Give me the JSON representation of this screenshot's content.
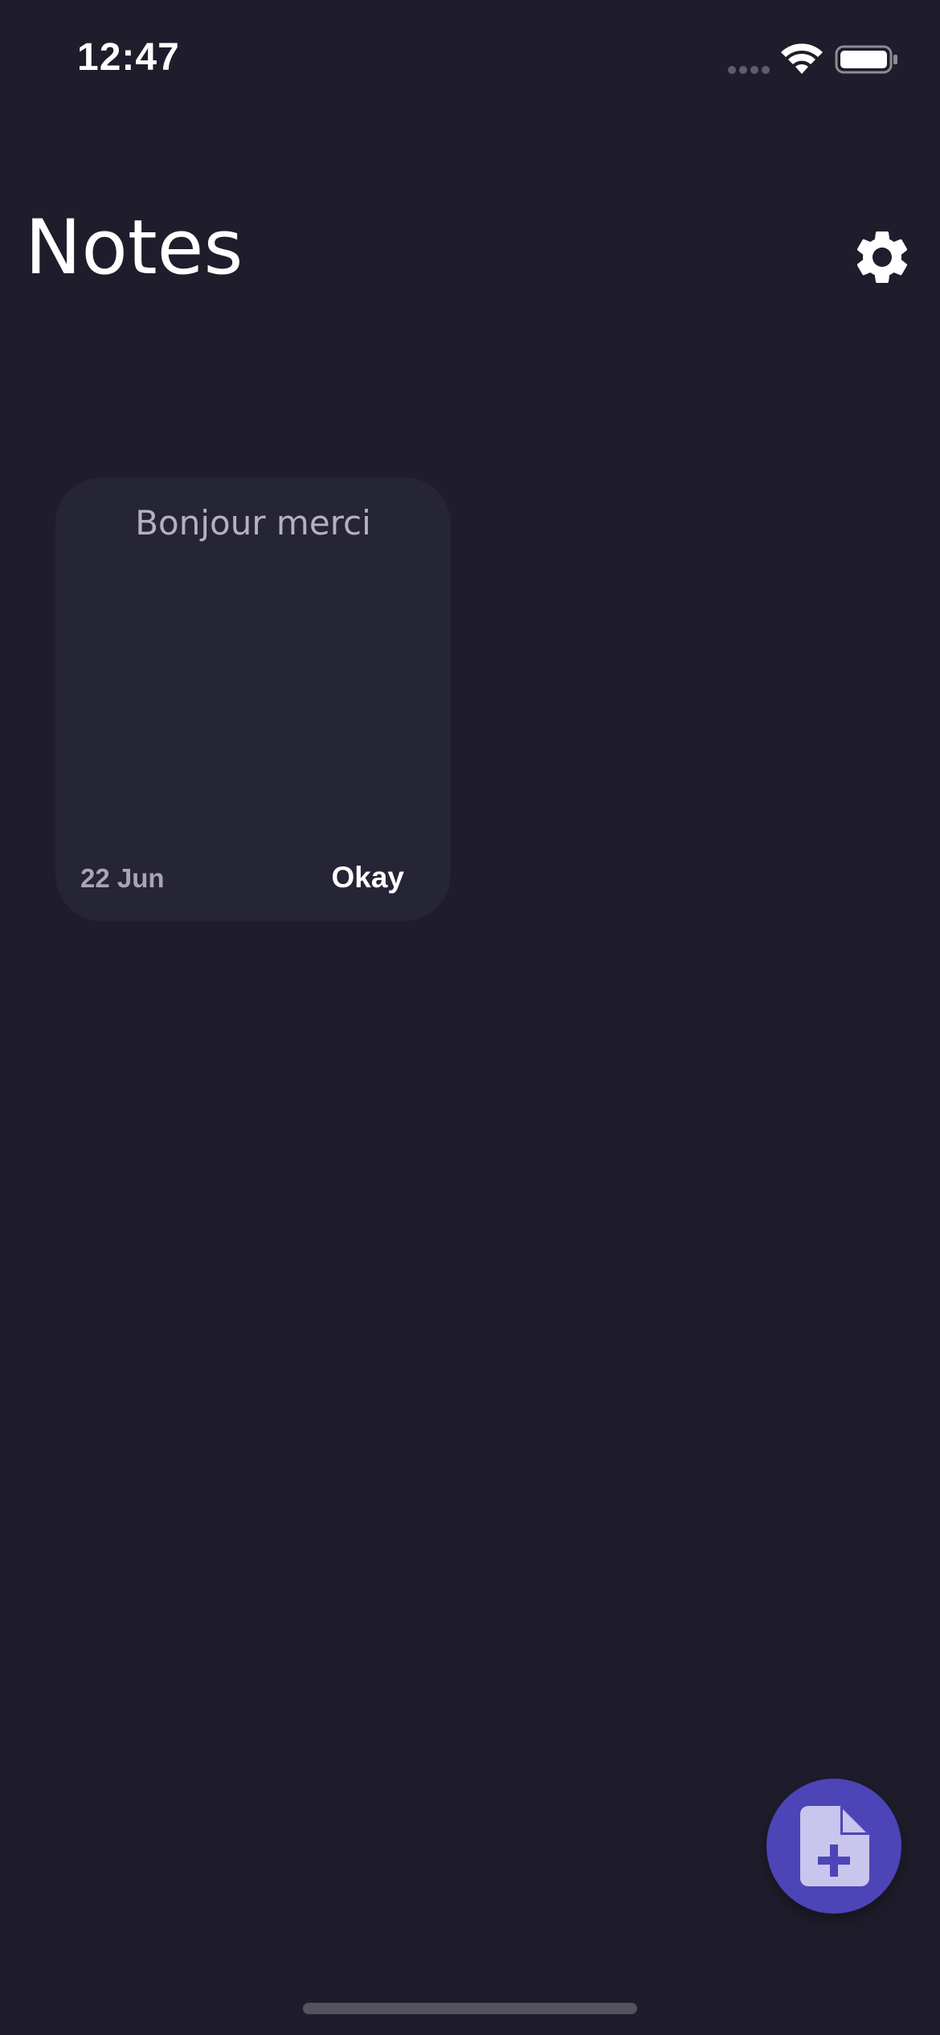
{
  "status_bar": {
    "time": "12:47",
    "icons": [
      "signal-icon",
      "wifi-icon",
      "battery-icon"
    ]
  },
  "header": {
    "title": "Notes",
    "settings_icon": "gear-icon"
  },
  "notes": [
    {
      "title": "Bonjour merci",
      "date": "22 Jun",
      "tag": "Okay"
    }
  ],
  "fab": {
    "icon": "add-note-icon"
  },
  "colors": {
    "background": "#1f1d2b",
    "card": "#262536",
    "accent": "#4d44b8",
    "accent_light": "#c9c5ec",
    "text_primary": "#ffffff",
    "text_muted": "#b4b2bf"
  }
}
